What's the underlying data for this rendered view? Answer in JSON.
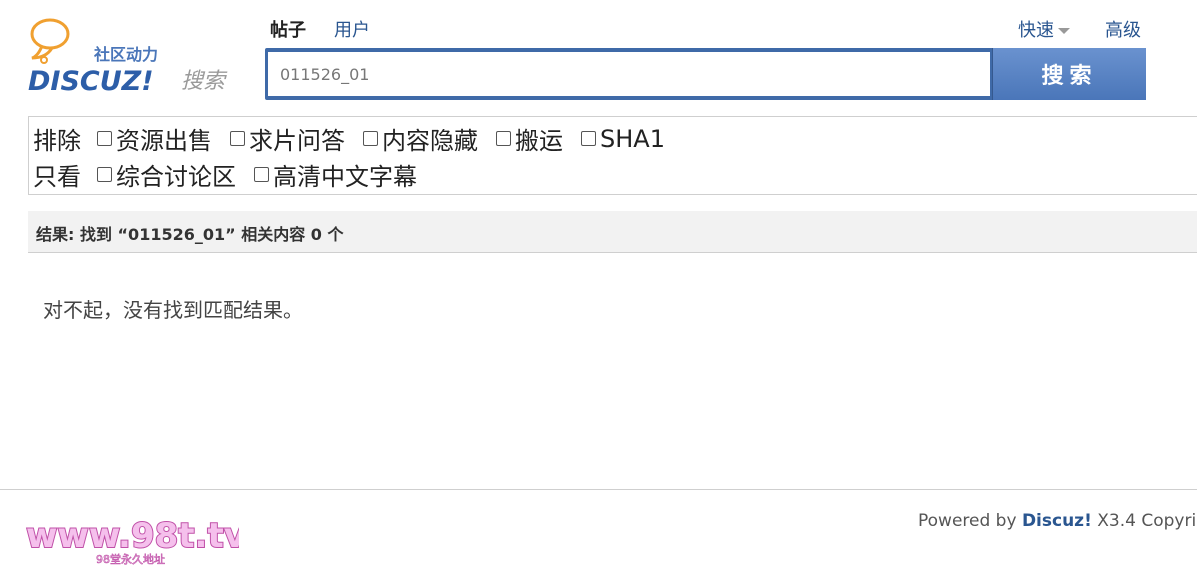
{
  "header": {
    "logo_tagline": "社区动力",
    "logo_brand": "DISCUZ!",
    "logo_search": "搜索"
  },
  "tabs": [
    {
      "label": "帖子",
      "active": true
    },
    {
      "label": "用户",
      "active": false
    }
  ],
  "nav": {
    "quick_label": "快速",
    "advanced_label": "高级"
  },
  "search": {
    "value": "011526_01",
    "button_label": "搜索"
  },
  "filters": {
    "exclude_label": "排除",
    "exclude_options": [
      "资源出售",
      "求片问答",
      "内容隐藏",
      "搬运",
      "SHA1"
    ],
    "only_label": "只看",
    "only_options": [
      "综合讨论区",
      "高清中文字幕"
    ]
  },
  "results": {
    "summary": "结果: 找到 “011526_01” 相关内容 0 个",
    "empty_message": "对不起，没有找到匹配结果。"
  },
  "footer": {
    "watermark_text": "www.98t.tv",
    "watermark_sub": "98堂永久地址",
    "powered_prefix": "Powered by",
    "powered_brand": "Discuz!",
    "powered_version": "X3.4",
    "copyright_partial": "Copyrig"
  },
  "colors": {
    "link": "#2a5690",
    "search_bar": "#3f6aa8",
    "search_button": "#5a84c4",
    "brand_blue": "#2d5ea8",
    "logo_orange": "#f0a030",
    "watermark_pink": "#e070c8"
  }
}
